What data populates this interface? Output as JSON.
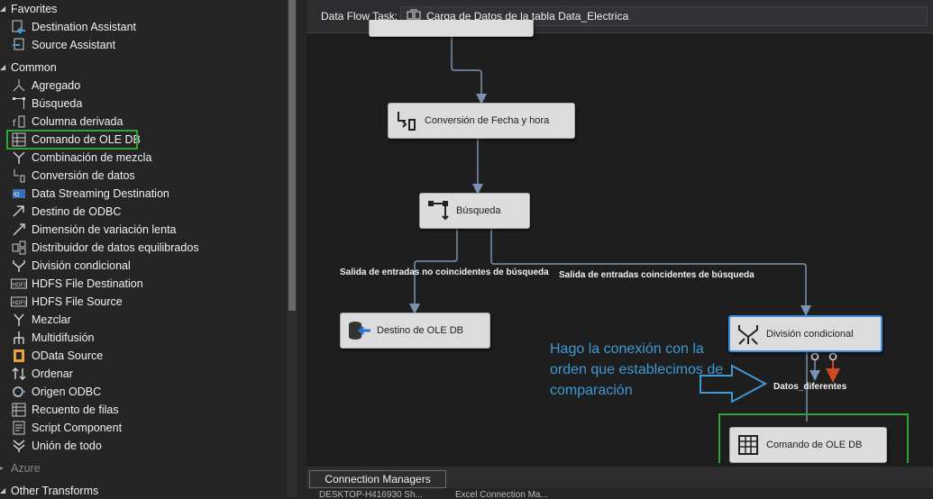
{
  "toolbox": {
    "favorites_header": "Favorites",
    "favorites": [
      {
        "label": "Destination Assistant",
        "icon": "destination-assistant-icon"
      },
      {
        "label": "Source Assistant",
        "icon": "source-assistant-icon"
      }
    ],
    "common_header": "Common",
    "common": [
      {
        "label": "Agregado",
        "icon": "aggregate-icon"
      },
      {
        "label": "Búsqueda",
        "icon": "lookup-icon"
      },
      {
        "label": "Columna derivada",
        "icon": "derived-column-icon"
      },
      {
        "label": "Comando de OLE DB",
        "icon": "ole-db-command-icon"
      },
      {
        "label": "Combinación de mezcla",
        "icon": "merge-join-icon"
      },
      {
        "label": "Conversión de datos",
        "icon": "data-conversion-icon"
      },
      {
        "label": "Data Streaming Destination",
        "icon": "data-streaming-icon"
      },
      {
        "label": "Destino de ODBC",
        "icon": "odbc-destination-icon"
      },
      {
        "label": "Dimensión de variación lenta",
        "icon": "scd-icon"
      },
      {
        "label": "Distribuidor de datos equilibrados",
        "icon": "balanced-distributor-icon"
      },
      {
        "label": "División condicional",
        "icon": "conditional-split-icon"
      },
      {
        "label": "HDFS File Destination",
        "icon": "hdfs-icon"
      },
      {
        "label": "HDFS File Source",
        "icon": "hdfs-icon"
      },
      {
        "label": "Mezclar",
        "icon": "merge-icon"
      },
      {
        "label": "Multidifusión",
        "icon": "multicast-icon"
      },
      {
        "label": "OData Source",
        "icon": "odata-icon"
      },
      {
        "label": "Ordenar",
        "icon": "sort-icon"
      },
      {
        "label": "Origen ODBC",
        "icon": "odbc-source-icon"
      },
      {
        "label": "Recuento de filas",
        "icon": "row-count-icon"
      },
      {
        "label": "Script Component",
        "icon": "script-icon"
      },
      {
        "label": "Unión de todo",
        "icon": "union-all-icon"
      }
    ],
    "azure_header": "Azure",
    "other_header": "Other Transforms"
  },
  "designer": {
    "task_label": "Data Flow Task:",
    "task_value": "Carga de Datos de la tabla Data_Electrica",
    "components": {
      "conversion": "Conversión de Fecha y hora",
      "busqueda": "Búsqueda",
      "destino": "Destino de OLE DB",
      "division": "División condicional",
      "comando": "Comando de OLE DB"
    },
    "paths": {
      "no_match": "Salida de entradas no coincidentes de búsqueda",
      "match": "Salida de entradas coincidentes de búsqueda",
      "datos": "Datos_diferentes"
    },
    "annotation": "Hago la conexión con la orden que establecimos de comparación",
    "colors": {
      "highlight": "#2ea43a",
      "annotation": "#3d9ad6",
      "selection": "#3c8fe0",
      "error_arrow": "#d04a1e"
    }
  },
  "bottom": {
    "connection_managers_tab": "Connection Managers",
    "conn1": "DESKTOP-H416930 Sh...",
    "conn2": "Excel Connection Ma..."
  }
}
